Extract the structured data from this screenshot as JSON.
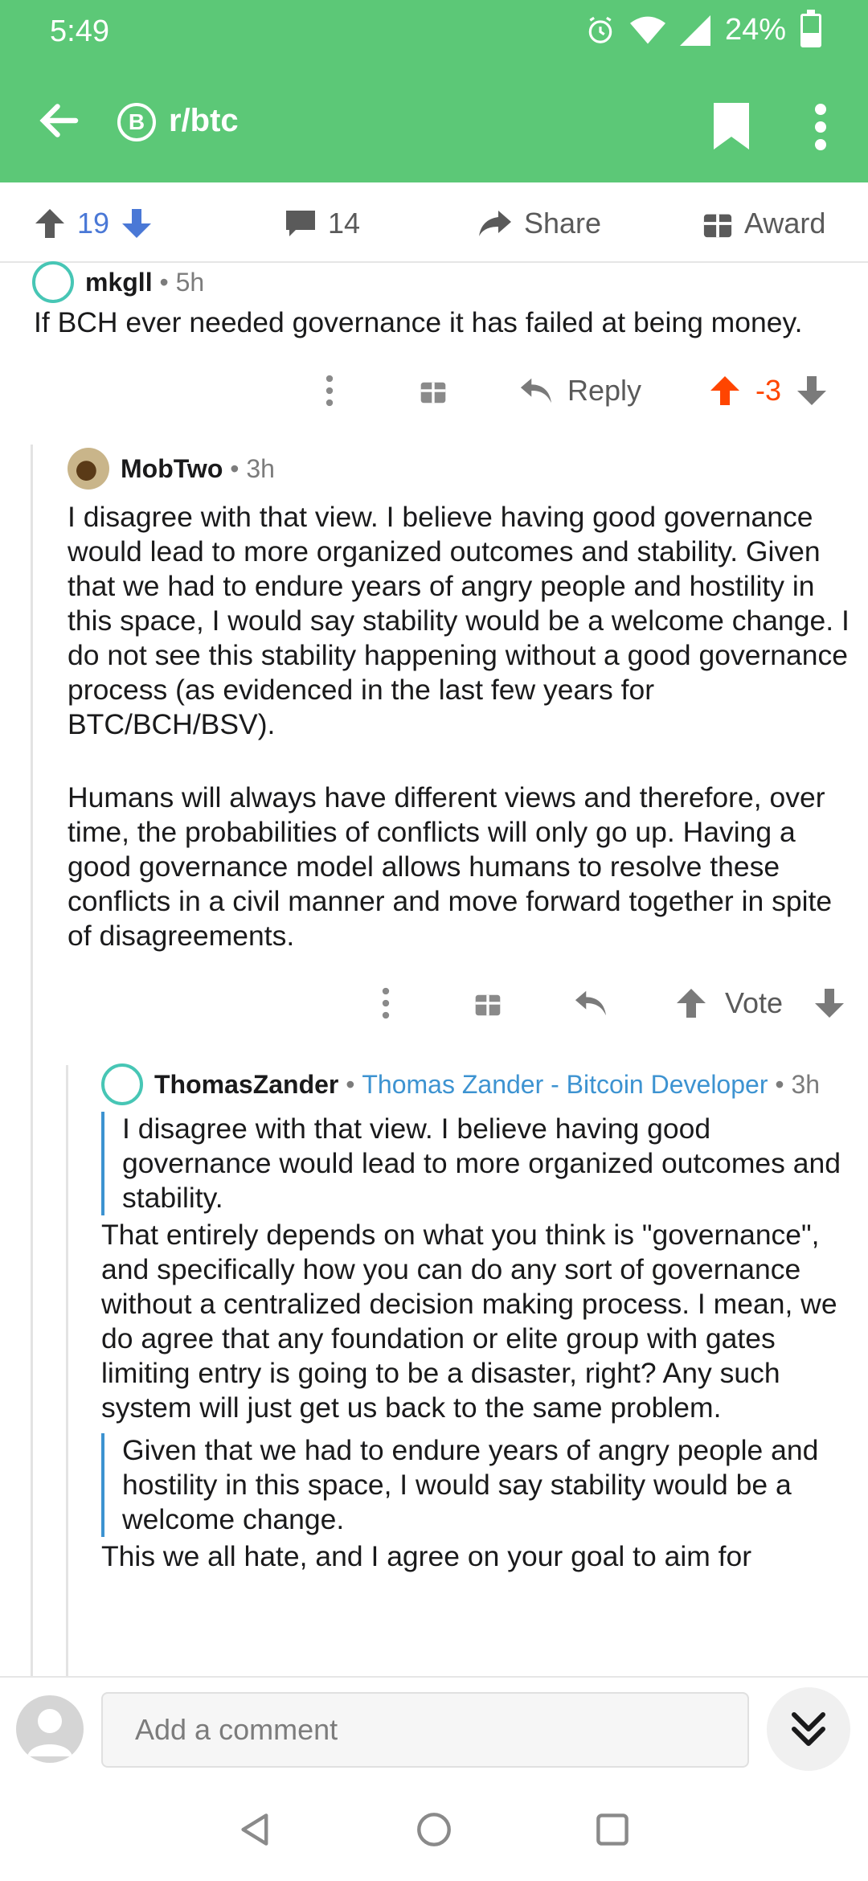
{
  "status": {
    "time": "5:49",
    "battery": "24%"
  },
  "toolbar": {
    "subreddit": "r/btc",
    "badge": "B"
  },
  "actions": {
    "upvotes": "19",
    "comments": "14",
    "share": "Share",
    "award": "Award"
  },
  "comments": [
    {
      "author": "mkgll",
      "time": "5h",
      "body": "If BCH ever needed governance it has failed at being money.",
      "reply_label": "Reply",
      "score": "-3"
    },
    {
      "author": "MobTwo",
      "time": "3h",
      "paragraphs": [
        "I disagree with that view. I believe having good governance would lead to more organized outcomes and stability. Given that we had to endure years of angry people and hostility in this space, I would say stability would be a welcome change. I do not see this stability happening without a good governance process (as evidenced in the last few years for BTC/BCH/BSV).",
        "Humans will always have different views and therefore, over time, the probabilities of conflicts will only go up. Having a good governance model allows humans to resolve these conflicts in a civil manner and move forward together in spite of disagreements."
      ],
      "vote_label": "Vote"
    },
    {
      "author": "ThomasZander",
      "flair": "Thomas Zander - Bitcoin Developer",
      "time": "3h",
      "quote1": "I disagree with that view. I believe having good governance would lead to more organized outcomes and stability.",
      "para1": "That entirely depends on what you think is \"governance\", and specifically how you can do any sort of governance without a centralized decision making process. I mean, we do agree that any foundation or elite group with gates limiting entry is going to be a disaster, right? Any such system will just get us back to the same problem.",
      "quote2": "Given that we had to endure years of angry people and hostility in this space, I would say stability would be a welcome change.",
      "para2": "This we all hate, and I agree on your goal to aim for"
    }
  ],
  "comment_box": {
    "placeholder": "Add a comment"
  },
  "colors": {
    "brand": "#5cc877",
    "upvote": "#ff4500",
    "blue": "#3d93d1"
  }
}
